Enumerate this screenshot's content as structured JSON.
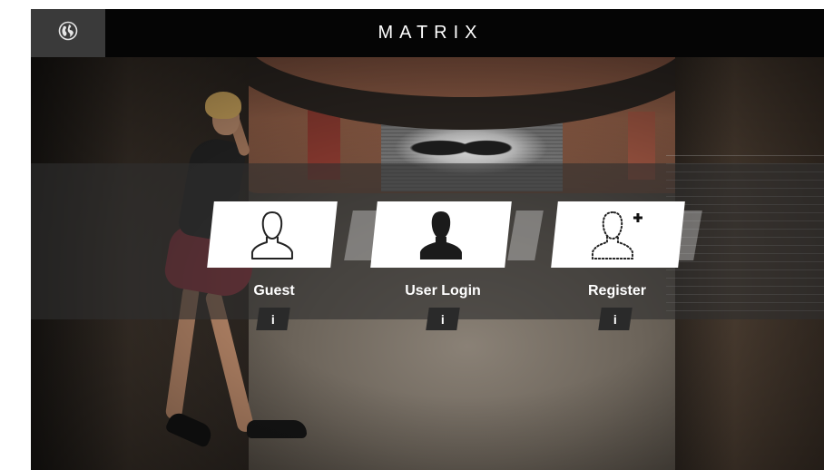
{
  "header": {
    "brand": "MATRIX",
    "language_icon": "globe-icon"
  },
  "options": [
    {
      "id": "guest",
      "label": "Guest",
      "icon": "user-outline-icon",
      "info_label": "i"
    },
    {
      "id": "user-login",
      "label": "User Login",
      "icon": "user-filled-icon",
      "info_label": "i"
    },
    {
      "id": "register",
      "label": "Register",
      "icon": "user-add-icon",
      "info_label": "i"
    }
  ],
  "colors": {
    "header_bg": "#050505",
    "lang_button_bg": "#3a3a3a",
    "tile_bg": "#ffffff",
    "band_bg": "rgba(46,46,46,0.62)",
    "info_button_bg": "#2a2a2a",
    "brand_accent": "#ffffff"
  }
}
